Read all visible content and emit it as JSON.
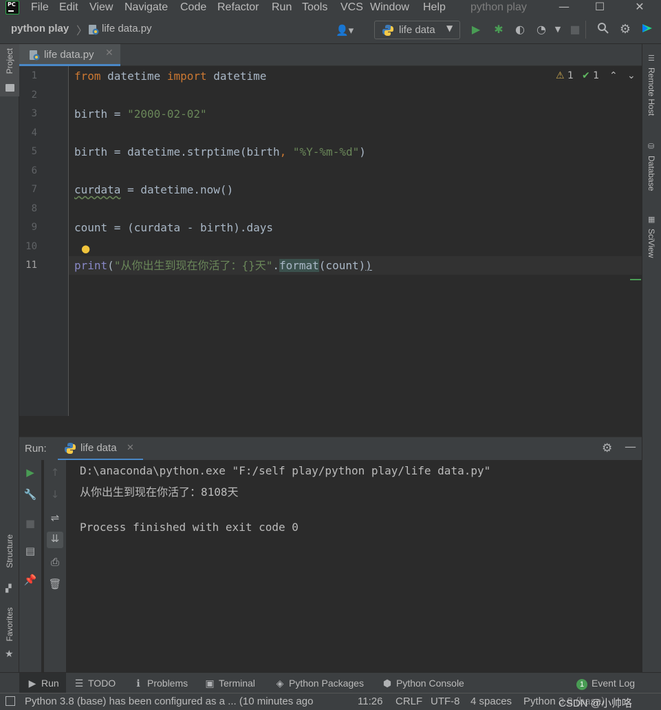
{
  "menubar": {
    "items": [
      "File",
      "Edit",
      "View",
      "Navigate",
      "Code",
      "Refactor",
      "Run",
      "Tools",
      "VCS",
      "Window",
      "Help"
    ],
    "window_title": "python play"
  },
  "navbar": {
    "project": "python play",
    "file": "life data.py",
    "run_config": "life data"
  },
  "tabs": [
    {
      "label": "life data.py",
      "active": true
    }
  ],
  "editor": {
    "inspections": {
      "warnings": "1",
      "weak_warnings": "1"
    },
    "lines": [
      {
        "n": "1"
      },
      {
        "n": "2"
      },
      {
        "n": "3"
      },
      {
        "n": "4"
      },
      {
        "n": "5"
      },
      {
        "n": "6"
      },
      {
        "n": "7"
      },
      {
        "n": "8"
      },
      {
        "n": "9"
      },
      {
        "n": "10"
      },
      {
        "n": "11"
      }
    ],
    "code": {
      "l1_from": "from",
      "l1_mod": " datetime ",
      "l1_import": "import",
      "l1_name": " datetime",
      "l3_var": "birth = ",
      "l3_str": "\"2000-02-02\"",
      "l5_a": "birth = datetime.strptime(birth",
      "l5_comma": ", ",
      "l5_str": "\"%Y-%m-%d\"",
      "l5_b": ")",
      "l7_var": "curdata",
      "l7_rest": " = datetime.now()",
      "l9": "count = (curdata - birth).days",
      "l11_print": "print",
      "l11_open": "(",
      "l11_str": "\"从你出生到现在你活了：{}天\"",
      "l11_dot": ".",
      "l11_fmt": "format",
      "l11_args": "(count)",
      "l11_close": ")"
    }
  },
  "run": {
    "label": "Run:",
    "tab": "life data",
    "output": [
      "D:\\anaconda\\python.exe \"F:/self play/python play/life data.py\"",
      "从你出生到现在你活了：8108天",
      "",
      "Process finished with exit code 0"
    ]
  },
  "toolwindows": {
    "left": [
      "Project",
      "Structure",
      "Favorites"
    ],
    "right": [
      "Remote Host",
      "Database",
      "SciView"
    ],
    "bottom": [
      "Run",
      "TODO",
      "Problems",
      "Terminal",
      "Python Packages",
      "Python Console"
    ],
    "event_log": "Event Log",
    "event_count": "1"
  },
  "statusbar": {
    "message": "Python 3.8 (base) has been configured as a ... (10 minutes ago",
    "position": "11:26",
    "line_sep": "CRLF",
    "encoding": "UTF-8",
    "indent": "4 spaces",
    "interpreter": "Python 3.8 (base)",
    "watermark": "CSDN @小帅咯"
  }
}
